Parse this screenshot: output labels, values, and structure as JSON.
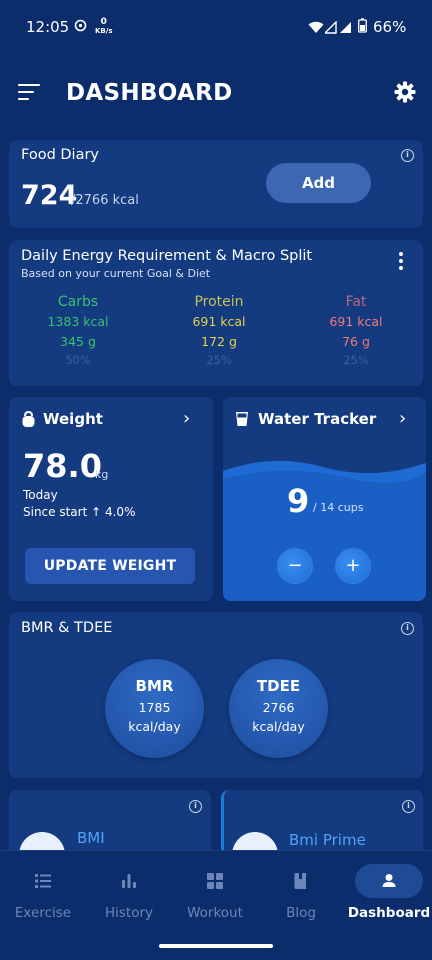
{
  "status_bar": {
    "time": "12:05",
    "net_speed_value": "0",
    "net_speed_unit": "KB/s",
    "battery": "66%"
  },
  "header": {
    "title": "DASHBOARD"
  },
  "food_diary": {
    "title": "Food Diary",
    "consumed": "724",
    "goal": "/2766 kcal",
    "add_label": "Add"
  },
  "macro_split": {
    "title": "Daily Energy Requirement & Macro Split",
    "subtitle": "Based on your current Goal & Diet",
    "columns": [
      {
        "name": "Carbs",
        "kcal": "1383 kcal",
        "grams": "345 g",
        "percent": "50%",
        "color": "#36c46e"
      },
      {
        "name": "Protein",
        "kcal": "691 kcal",
        "grams": "172 g",
        "percent": "25%",
        "color": "#e6d24a"
      },
      {
        "name": "Fat",
        "kcal": "691 kcal",
        "grams": "76 g",
        "percent": "25%",
        "color": "#f07a78"
      }
    ]
  },
  "weight": {
    "title": "Weight",
    "value": "78.0",
    "unit": "kg",
    "date_label": "Today",
    "since_start": "Since start ↑ 4.0%",
    "update_label": "UPDATE WEIGHT"
  },
  "water": {
    "title": "Water Tracker",
    "count": "9",
    "goal": "/ 14 cups",
    "minus": "−",
    "plus": "+"
  },
  "bmr_tdee": {
    "title": "BMR & TDEE",
    "bmr": {
      "label": "BMR",
      "value": "1785",
      "unit": "kcal/day"
    },
    "tdee": {
      "label": "TDEE",
      "value": "2766",
      "unit": "kcal/day"
    }
  },
  "bmi": {
    "title": "BMI"
  },
  "bmi_prime": {
    "title": "Bmi Prime"
  },
  "nav": {
    "items": [
      {
        "label": "Exercise",
        "icon": "list-icon"
      },
      {
        "label": "History",
        "icon": "bar-chart-icon"
      },
      {
        "label": "Workout",
        "icon": "grid-icon"
      },
      {
        "label": "Blog",
        "icon": "book-icon"
      },
      {
        "label": "Dashboard",
        "icon": "person-icon"
      }
    ],
    "active": "Dashboard"
  },
  "colors": {
    "background": "#0c2d6b",
    "card": "#143a80",
    "accent": "#1e6bd6"
  }
}
